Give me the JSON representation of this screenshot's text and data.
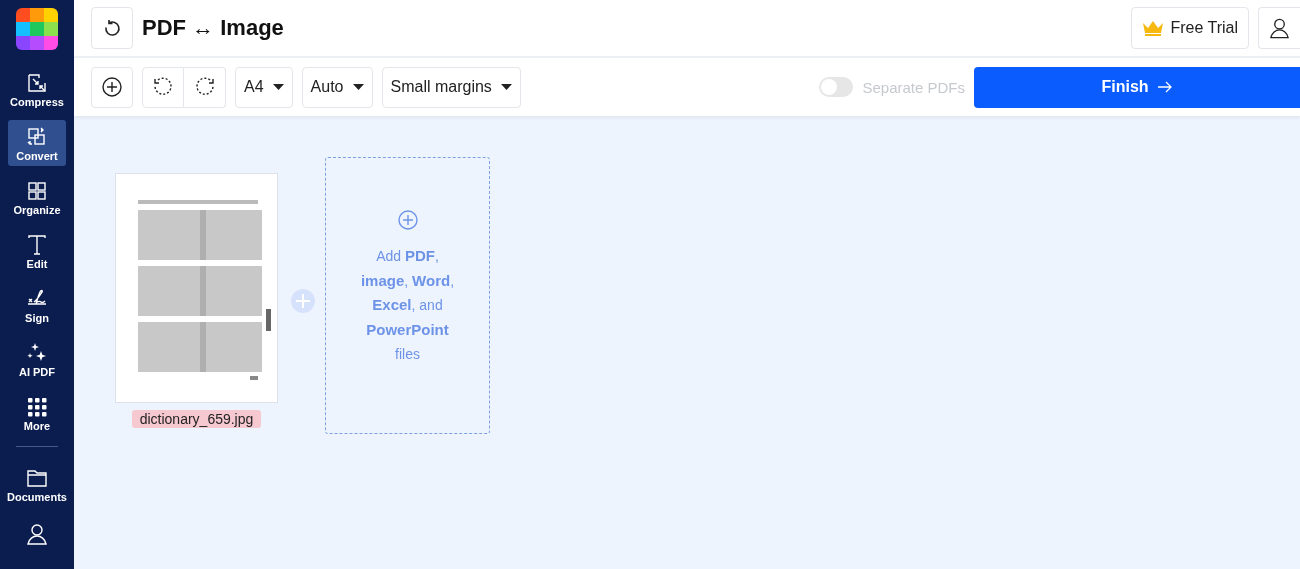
{
  "sidebar": {
    "items": [
      {
        "label": "Compress",
        "selected": false
      },
      {
        "label": "Convert",
        "selected": true
      },
      {
        "label": "Organize",
        "selected": false
      },
      {
        "label": "Edit",
        "selected": false
      },
      {
        "label": "Sign",
        "selected": false
      },
      {
        "label": "AI PDF",
        "selected": false
      },
      {
        "label": "More",
        "selected": false
      },
      {
        "label": "Documents",
        "selected": false
      }
    ]
  },
  "header": {
    "title": "PDF ↔ Image",
    "trial_button": "Free Trial"
  },
  "toolbar": {
    "dropdowns": [
      {
        "value": "A4"
      },
      {
        "value": "Auto"
      },
      {
        "value": "Small margins"
      }
    ],
    "separate_pdfs": {
      "label": "Separate PDFs",
      "on": false,
      "disabled": true
    },
    "finish_button": "Finish"
  },
  "files": [
    {
      "name": "dictionary_659.jpg",
      "kind": "picture"
    }
  ],
  "drop_zone": {
    "text": "Add **PDF**, **image**, **Word**, **Excel**, and **PowerPoint** files"
  }
}
